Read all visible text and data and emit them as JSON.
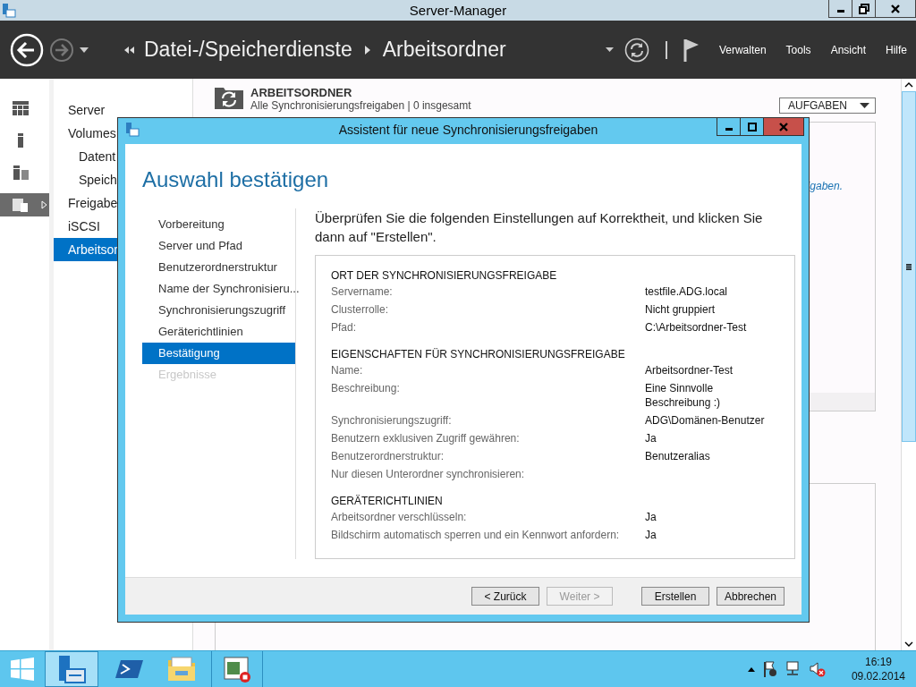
{
  "window": {
    "title": "Server-Manager"
  },
  "header": {
    "breadcrumb": [
      "Datei-/Speicherdienste",
      "Arbeitsordner"
    ],
    "menu": [
      "Verwalten",
      "Tools",
      "Ansicht",
      "Hilfe"
    ]
  },
  "rail": [
    {
      "kind": "dashboard",
      "selected": false
    },
    {
      "kind": "server",
      "selected": false
    },
    {
      "kind": "all-servers",
      "selected": false
    },
    {
      "kind": "files",
      "selected": true
    }
  ],
  "nav": {
    "items": [
      {
        "label": "Server",
        "selected": false
      },
      {
        "label": "Volumes",
        "selected": false,
        "children": [
          {
            "label": "Datent",
            "selected": false
          },
          {
            "label": "Speich",
            "selected": false
          }
        ]
      },
      {
        "label": "Freigabe",
        "selected": false
      },
      {
        "label": "iSCSI",
        "selected": false
      },
      {
        "label": "Arbeitsor",
        "selected": true
      }
    ]
  },
  "main": {
    "title": "ARBEITSORDNER",
    "subtitle": "Alle Synchronisierungsfreigaben | 0 insgesamt",
    "tasks_button": "AUFGABEN",
    "link_fragment": "igaben."
  },
  "dialog": {
    "title": "Assistent für neue Synchronisierungsfreigaben",
    "heading": "Auswahl bestätigen",
    "steps": [
      {
        "label": "Vorbereitung",
        "selected": false,
        "disabled": false
      },
      {
        "label": "Server und Pfad",
        "selected": false,
        "disabled": false
      },
      {
        "label": "Benutzerordnerstruktur",
        "selected": false,
        "disabled": false
      },
      {
        "label": "Name der Synchronisieru...",
        "selected": false,
        "disabled": false
      },
      {
        "label": "Synchronisierungszugriff",
        "selected": false,
        "disabled": false
      },
      {
        "label": "Geräterichtlinien",
        "selected": false,
        "disabled": false
      },
      {
        "label": "Bestätigung",
        "selected": true,
        "disabled": false
      },
      {
        "label": "Ergebnisse",
        "selected": false,
        "disabled": true
      }
    ],
    "intro": "Überprüfen Sie die folgenden Einstellungen auf Korrektheit, und klicken Sie dann auf \"Erstellen\".",
    "sections": [
      {
        "title": "ORT DER SYNCHRONISIERUNGSFREIGABE",
        "rows": [
          {
            "label": "Servername:",
            "value": "testfile.ADG.local"
          },
          {
            "label": "Clusterrolle:",
            "value": "Nicht gruppiert"
          },
          {
            "label": "Pfad:",
            "value": "C:\\Arbeitsordner-Test"
          }
        ]
      },
      {
        "title": "EIGENSCHAFTEN FÜR SYNCHRONISIERUNGSFREIGABE",
        "rows": [
          {
            "label": "Name:",
            "value": "Arbeitsordner-Test"
          },
          {
            "label": "Beschreibung:",
            "value": "Eine Sinnvolle Beschreibung :)"
          },
          {
            "label": "Synchronisierungszugriff:",
            "value": "ADG\\Domänen-Benutzer"
          },
          {
            "label": "Benutzern exklusiven Zugriff gewähren:",
            "value": "Ja"
          },
          {
            "label": "Benutzerordnerstruktur:",
            "value": "Benutzeralias"
          },
          {
            "label": "Nur diesen Unterordner synchronisieren:"
          }
        ]
      },
      {
        "title": "GERÄTERICHTLINIEN",
        "rows": [
          {
            "label": "Arbeitsordner verschlüsseln:",
            "value": "Ja"
          },
          {
            "label": "Bildschirm automatisch sperren und ein Kennwort anfordern:",
            "value": "Ja"
          }
        ]
      }
    ],
    "buttons": [
      {
        "label": "< Zurück",
        "disabled": false
      },
      {
        "label": "Weiter >",
        "disabled": true
      },
      {
        "label": "Erstellen",
        "disabled": false
      },
      {
        "label": "Abbrechen",
        "disabled": false
      }
    ]
  },
  "taskbar": {
    "apps": [
      {
        "kind": "server-manager",
        "selected": true
      },
      {
        "kind": "powershell",
        "selected": false
      },
      {
        "kind": "explorer",
        "selected": false
      },
      {
        "kind": "monitor",
        "selected": false
      }
    ],
    "clock": {
      "time": "16:19",
      "date": "09.02.2014"
    }
  }
}
